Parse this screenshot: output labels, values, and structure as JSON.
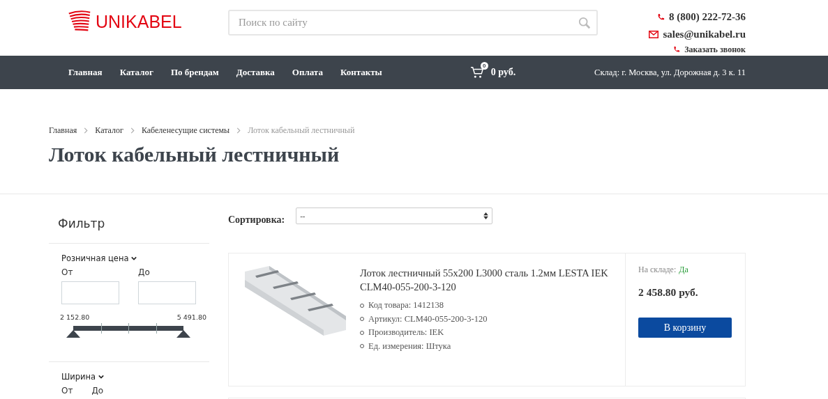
{
  "header": {
    "logo": "UNIKABEL",
    "search": {
      "placeholder": "Поиск по сайту"
    },
    "phone": "8 (800) 222-72-36",
    "email": "sales@unikabel.ru",
    "callback": "Заказать звонок"
  },
  "nav": {
    "items": [
      {
        "label": "Главная"
      },
      {
        "label": "Каталог"
      },
      {
        "label": "По брендам"
      },
      {
        "label": "Доставка"
      },
      {
        "label": "Оплата"
      },
      {
        "label": "Контакты"
      }
    ],
    "cart": {
      "count": "0",
      "total": "0 руб."
    },
    "warehouse": "Склад: г. Москва, ул. Дорожная д. 3 к. 11"
  },
  "breadcrumbs": [
    "Главная",
    "Каталог",
    "Кабеленесущие системы",
    "Лоток кабельный лестничный"
  ],
  "title": "Лоток кабельный лестничный",
  "filter": {
    "title": "Фильтр",
    "groups": [
      {
        "label": "Розничная цена",
        "expanded": true,
        "from_label": "От",
        "to_label": "До",
        "min": "2 152.80",
        "max": "5 491.80",
        "low": {
          "level": 0
        },
        "high": {
          "level": 1
        }
      },
      {
        "label": "Ширина",
        "expanded": true,
        "from_label": "От",
        "to_label": "До"
      }
    ]
  },
  "sort": {
    "label": "Сортировка:",
    "value": "--"
  },
  "products": [
    {
      "kind": "picture",
      "name": "Лоток лестничный 55x200 L3000 сталь 1.2мм LESTA IEK CLM40-055-200-3-120",
      "specs": [
        "Код товара: 1412138",
        "Артикул: CLM40-055-200-3-120",
        "Производитель: IEK",
        "Ед. измерения: Штука"
      ],
      "stock_label": "На складе:",
      "stock_value": "Да",
      "in_stock": true,
      "price": "2 458.80 руб.",
      "button": "В корзину"
    }
  ]
}
